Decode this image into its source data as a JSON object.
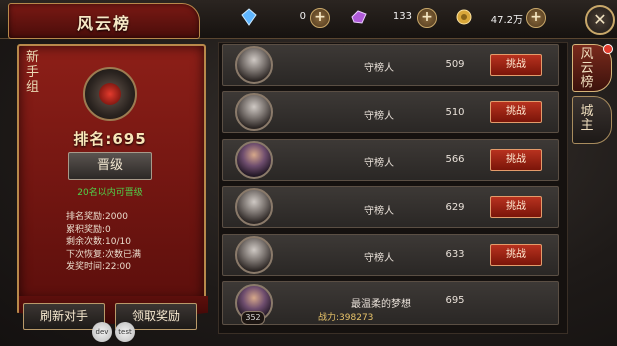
{
  "header": {
    "title": "风云榜",
    "resources": [
      {
        "icon": "blue-crystal-icon",
        "value": "0"
      },
      {
        "icon": "purple-gem-icon",
        "value": "133"
      },
      {
        "icon": "gold-coin-icon",
        "value": "47.2万"
      }
    ]
  },
  "left_panel": {
    "group_label": "新手组",
    "rank_text": "排名:695",
    "promote_button": "晋级",
    "promote_hint": "20名以内可晋级",
    "stats": [
      {
        "label": "排名奖励:",
        "value": "2000"
      },
      {
        "label": "累积奖励:",
        "value": "0"
      },
      {
        "label": "剩余次数:",
        "value": "10/10"
      },
      {
        "label": "下次恢复:",
        "value": "次数已满"
      },
      {
        "label": "发奖时间:",
        "value": "22:00"
      }
    ],
    "refresh_button": "刷新对手",
    "claim_button": "领取奖励",
    "debug_buttons": [
      "dev",
      "test"
    ]
  },
  "list": {
    "challenge_label": "挑战",
    "rows": [
      {
        "name": "守榜人",
        "rank": "509"
      },
      {
        "name": "守榜人",
        "rank": "510"
      },
      {
        "name": "守榜人",
        "rank": "566"
      },
      {
        "name": "守榜人",
        "rank": "629"
      },
      {
        "name": "守榜人",
        "rank": "633"
      }
    ],
    "self_row": {
      "level": "352",
      "name": "最温柔的梦想",
      "rank": "695",
      "power_label": "战力:",
      "power_value": "398273"
    }
  },
  "side_tabs": [
    {
      "label": "风云榜"
    },
    {
      "label": "城主"
    }
  ]
}
